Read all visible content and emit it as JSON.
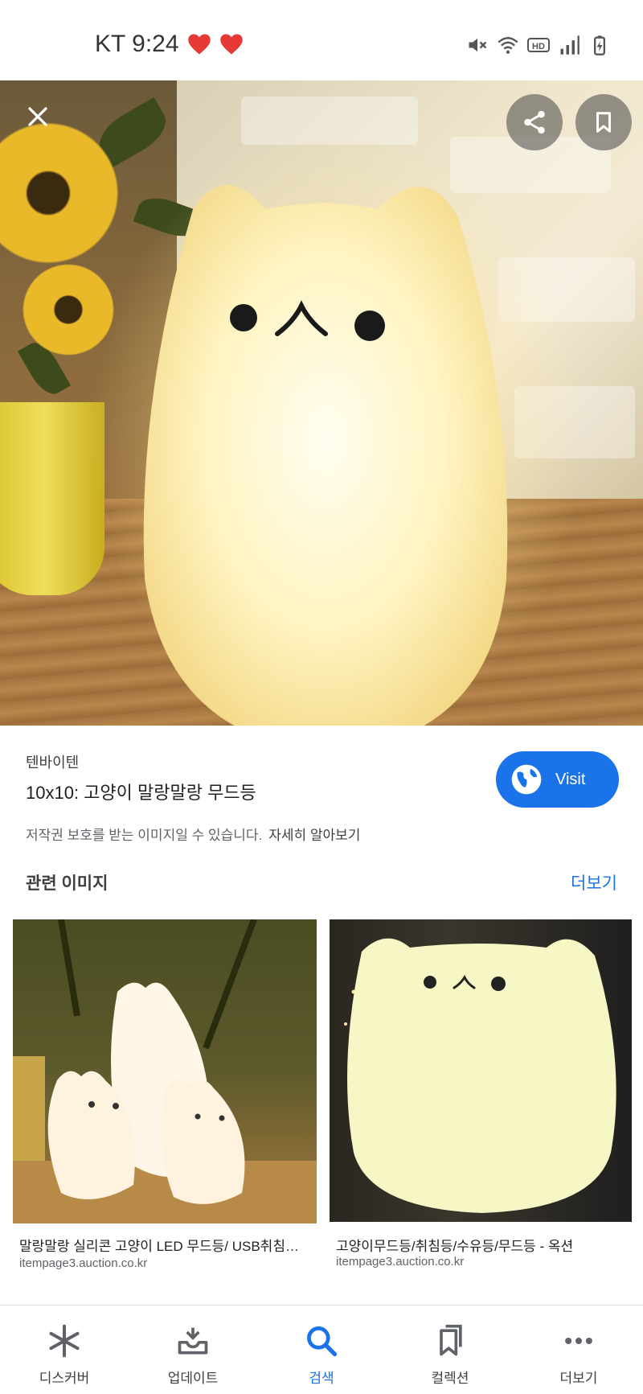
{
  "status_bar": {
    "carrier_time": "KT 9:24",
    "notification_icons": [
      "heart-icon",
      "heart-icon"
    ],
    "system_icons": [
      "mute-icon",
      "wifi-icon",
      "hd-icon",
      "signal-icon",
      "battery-icon"
    ]
  },
  "hero": {
    "close_icon": "close-icon",
    "share_icon": "share-icon",
    "bookmark_icon": "bookmark-icon"
  },
  "result": {
    "source": "텐바이텐",
    "title": "10x10: 고양이 말랑말랑 무드등",
    "visit_label": "Visit",
    "copyright_notice": "저작권 보호를 받는 이미지일 수 있습니다.",
    "learn_more": "자세히 알아보기"
  },
  "related": {
    "heading": "관련 이미지",
    "more_label": "더보기",
    "items": [
      {
        "caption": "말랑말랑 실리콘 고양이 LED 무드등/ USB취침등 ...",
        "source": "itempage3.auction.co.kr"
      },
      {
        "caption": "고양이무드등/취침등/수유등/무드등 - 옥션",
        "source": "itempage3.auction.co.kr"
      }
    ]
  },
  "bottom_nav": {
    "items": [
      {
        "label": "디스커버",
        "icon": "asterisk-icon",
        "active": false
      },
      {
        "label": "업데이트",
        "icon": "inbox-update-icon",
        "active": false
      },
      {
        "label": "검색",
        "icon": "search-icon",
        "active": true
      },
      {
        "label": "컬렉션",
        "icon": "collections-icon",
        "active": false
      },
      {
        "label": "더보기",
        "icon": "more-dots-icon",
        "active": false
      }
    ]
  },
  "colors": {
    "accent": "#1a73e8",
    "heart": "#e53935",
    "text_primary": "#202124",
    "text_secondary": "#5f6368"
  }
}
